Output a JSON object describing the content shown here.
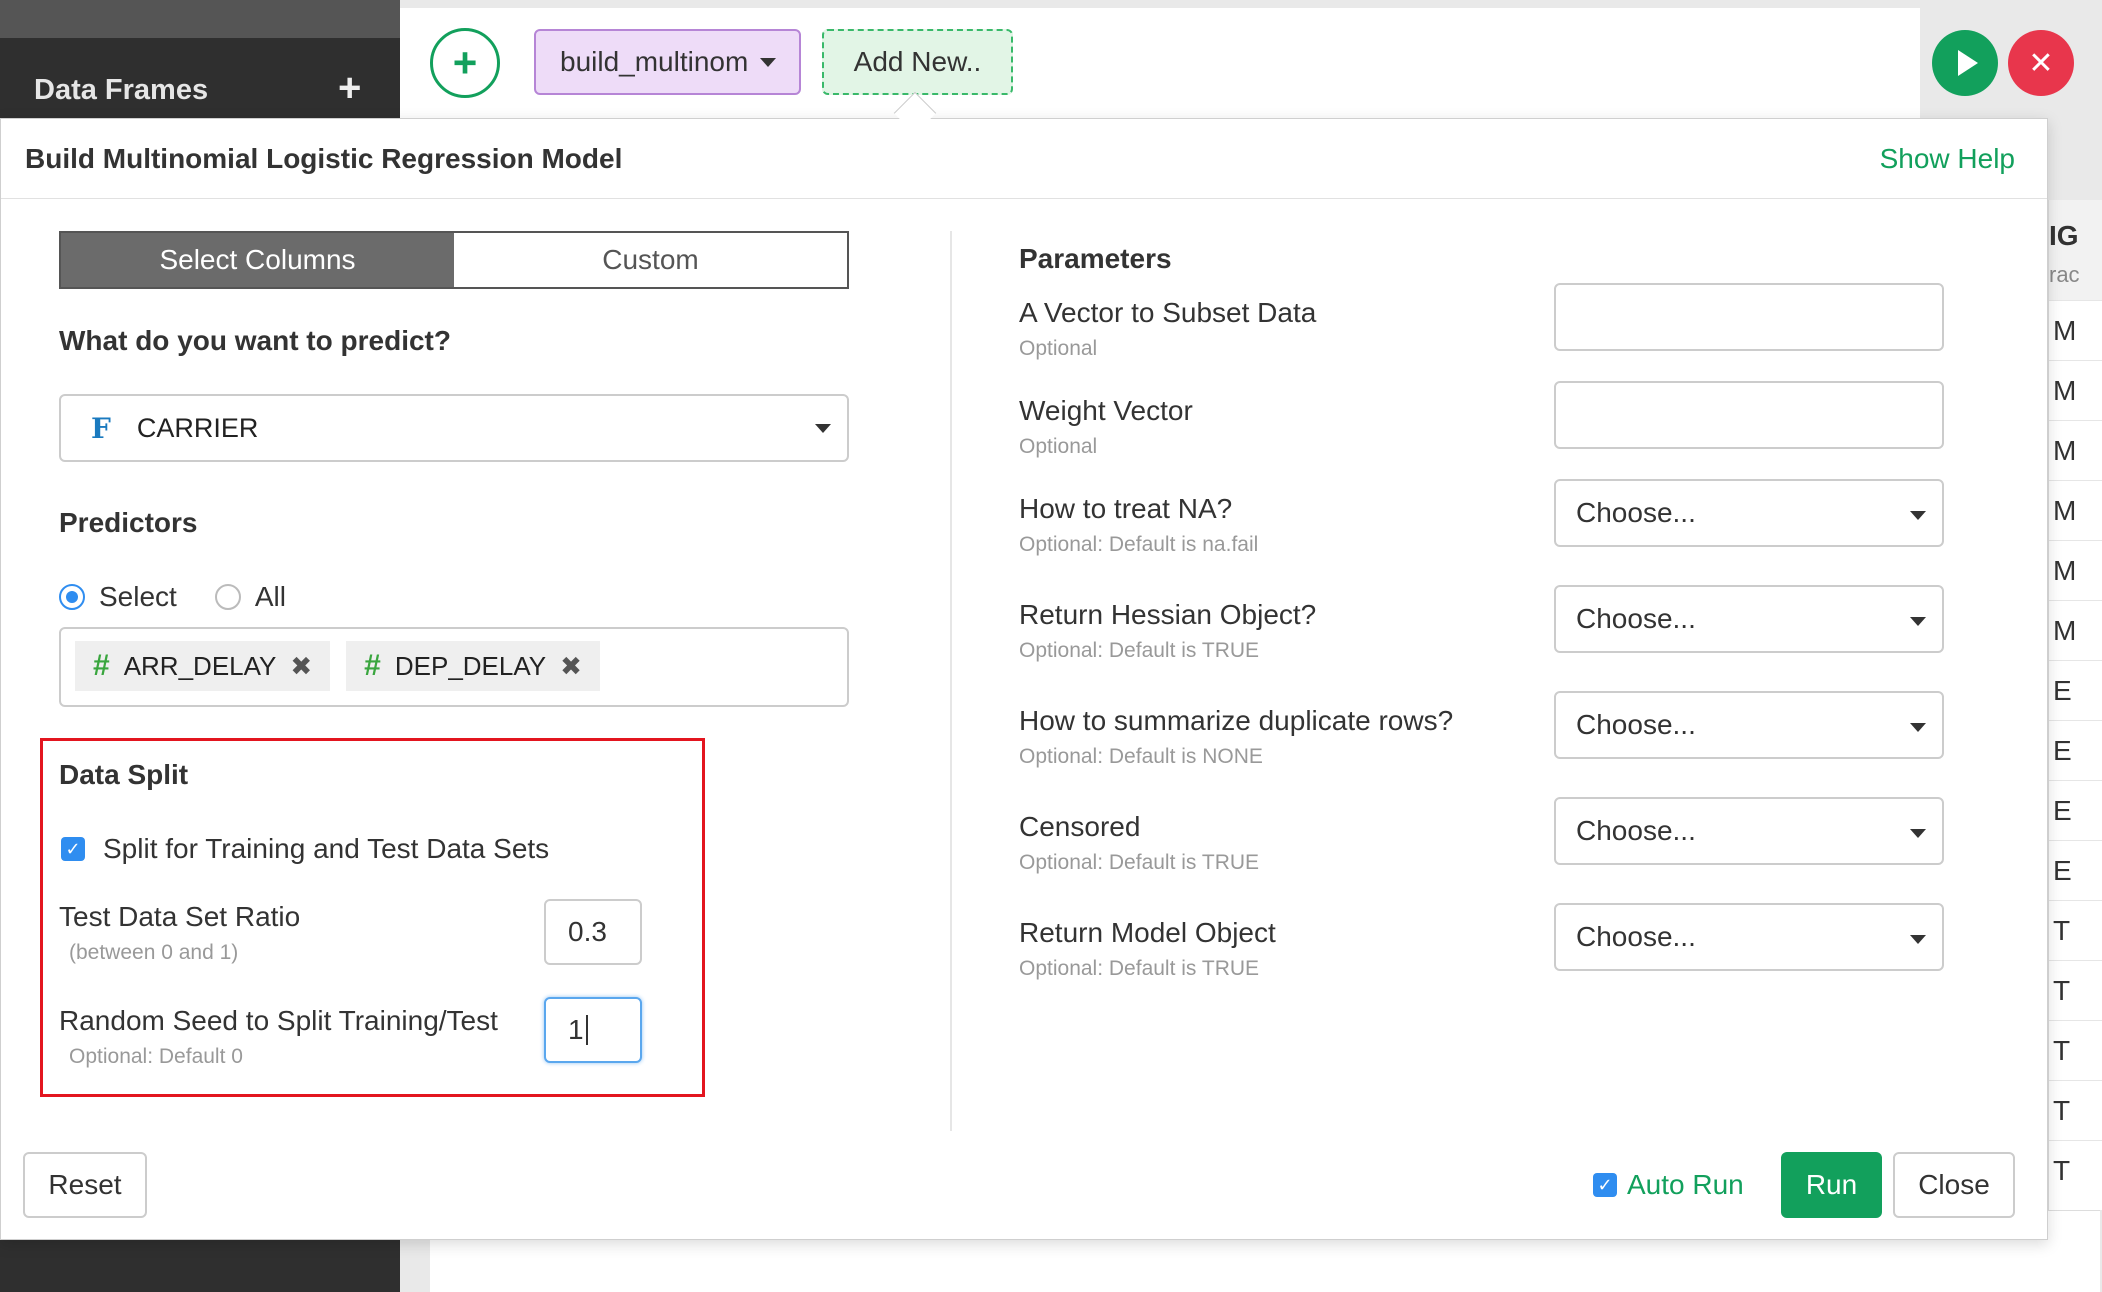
{
  "sidebar": {
    "title": "Data Frames"
  },
  "topbar": {
    "step_name": "build_multinom",
    "add_new": "Add New.."
  },
  "background_column": {
    "header": "IG",
    "subheader": "rac",
    "cells": [
      "M",
      "M",
      "M",
      "M",
      "M",
      "M",
      "E",
      "E",
      "E",
      "E",
      "T",
      "T",
      "T",
      "T",
      "T"
    ]
  },
  "modal": {
    "title": "Build Multinomial Logistic Regression Model",
    "show_help": "Show Help",
    "tabs": [
      "Select Columns",
      "Custom"
    ],
    "predict_question": "What do you want to predict?",
    "target": {
      "type_icon": "F",
      "value": "CARRIER"
    },
    "predictors_label": "Predictors",
    "predictor_mode": {
      "select": "Select",
      "all": "All",
      "selected": "Select"
    },
    "predictor_tags": [
      {
        "icon": "#",
        "name": "ARR_DELAY"
      },
      {
        "icon": "#",
        "name": "DEP_DELAY"
      }
    ],
    "data_split": {
      "title": "Data Split",
      "split_checkbox_label": "Split for Training and Test Data Sets",
      "split_checked": true,
      "ratio_label": "Test Data Set Ratio",
      "ratio_sub": "(between 0 and 1)",
      "ratio_value": "0.3",
      "seed_label": "Random Seed to Split Training/Test",
      "seed_sub": "Optional: Default 0",
      "seed_value": "1"
    },
    "parameters": {
      "title": "Parameters",
      "items": [
        {
          "label": "A Vector to Subset Data",
          "sub": "Optional",
          "kind": "input",
          "value": ""
        },
        {
          "label": "Weight Vector",
          "sub": "Optional",
          "kind": "input",
          "value": ""
        },
        {
          "label": "How to treat NA?",
          "sub": "Optional: Default is na.fail",
          "kind": "select",
          "value": "Choose..."
        },
        {
          "label": "Return Hessian Object?",
          "sub": "Optional: Default is TRUE",
          "kind": "select",
          "value": "Choose..."
        },
        {
          "label": "How to summarize duplicate rows?",
          "sub": "Optional: Default is NONE",
          "kind": "select",
          "value": "Choose..."
        },
        {
          "label": "Censored",
          "sub": "Optional: Default is TRUE",
          "kind": "select",
          "value": "Choose..."
        },
        {
          "label": "Return Model Object",
          "sub": "Optional: Default is TRUE",
          "kind": "select",
          "value": "Choose..."
        }
      ]
    },
    "footer": {
      "reset": "Reset",
      "auto_run": "Auto Run",
      "auto_run_checked": true,
      "run": "Run",
      "close": "Close"
    }
  },
  "colors": {
    "accent_green": "#12a05c",
    "stop_red": "#e8364c",
    "highlight_red": "#e3151f",
    "checkbox_blue": "#2f8df0"
  }
}
